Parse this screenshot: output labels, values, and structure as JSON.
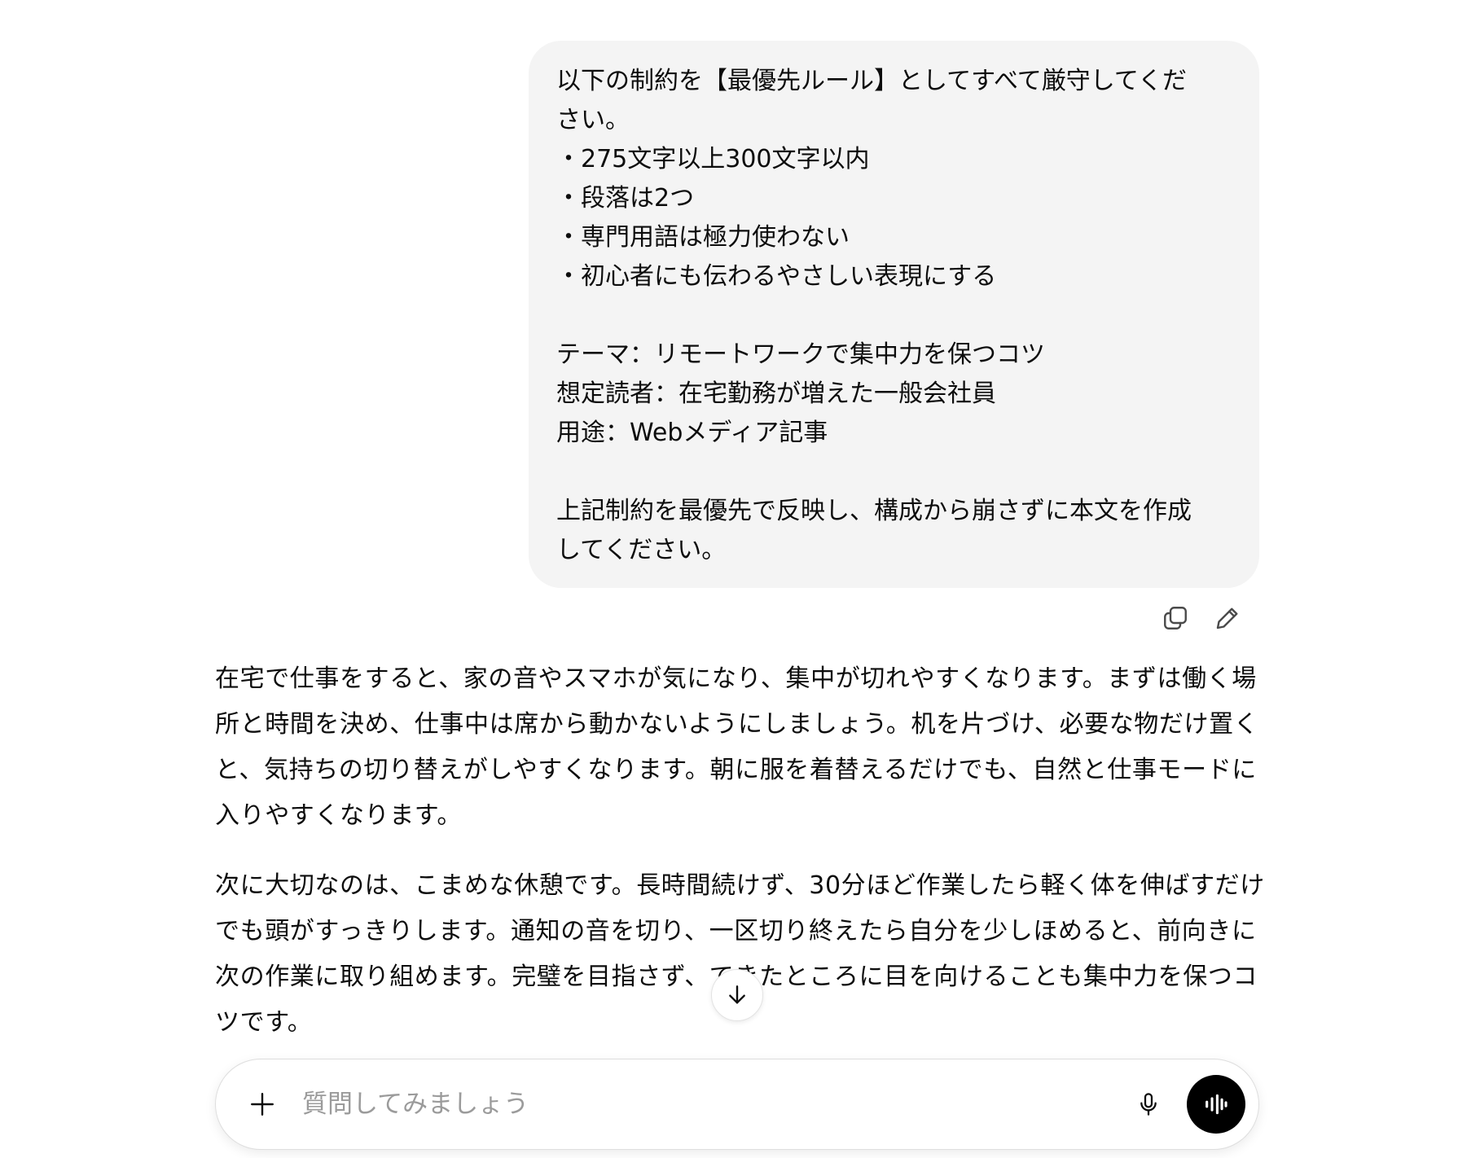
{
  "user_message": {
    "lines": [
      "以下の制約を【最優先ルール】としてすべて厳守してくだ",
      "さい。",
      "・275文字以上300文字以内",
      "・段落は2つ",
      "・専門用語は極力使わない",
      "・初心者にも伝わるやさしい表現にする",
      "",
      "テーマ：リモートワークで集中力を保つコツ",
      "想定読者：在宅勤務が増えた一般会社員",
      "用途：Webメディア記事",
      "",
      "上記制約を最優先で反映し、構成から崩さずに本文を作成",
      "してください。"
    ]
  },
  "message_actions": {
    "copy_icon": "copy-icon",
    "edit_icon": "pencil-icon"
  },
  "assistant_message": {
    "paragraphs": [
      "在宅で仕事をすると、家の音やスマホが気になり、集中が切れやすくなります。まずは働く場所と時間を決め、仕事中は席から動かないようにしましょう。机を片づけ、必要な物だけ置くと、気持ちの切り替えがしやすくなります。朝に服を着替えるだけでも、自然と仕事モードに入りやすくなります。",
      "次に大切なのは、こまめな休憩です。長時間続けず、30分ほど作業したら軽く体を伸ばすだけでも頭がすっきりします。通知の音を切り、一区切り終えたら自分を少しほめると、前向きに次の作業に取り組めます。完璧を目指さず、できたところに目を向けることも集中力を保つコツです。"
    ]
  },
  "scroll_button": {
    "icon": "arrow-down-icon"
  },
  "composer": {
    "placeholder": "質問してみましょう",
    "value": "",
    "plus_icon": "plus-icon",
    "mic_icon": "microphone-icon",
    "voice_icon": "voice-waveform-icon"
  }
}
